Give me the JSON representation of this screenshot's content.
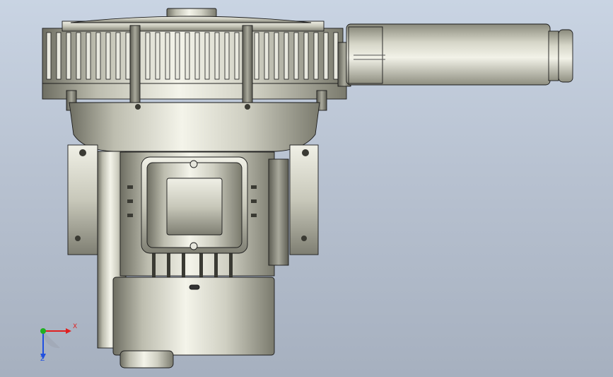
{
  "viewport": {
    "background_top": "#c9d4e3",
    "background_bottom": "#a6b0bf"
  },
  "model": {
    "name_icon": "ring-blower-motor-assembly-icon",
    "body_color": "#cfcfc2",
    "edge_color": "#1a1a1a",
    "shade_color": "#8f8f82",
    "highlight_color": "#f5f5ec"
  },
  "triad": {
    "x_label": "X",
    "z_label": "Z",
    "x_color": "#e02020",
    "y_color": "#20b020",
    "z_color": "#2050e0"
  }
}
